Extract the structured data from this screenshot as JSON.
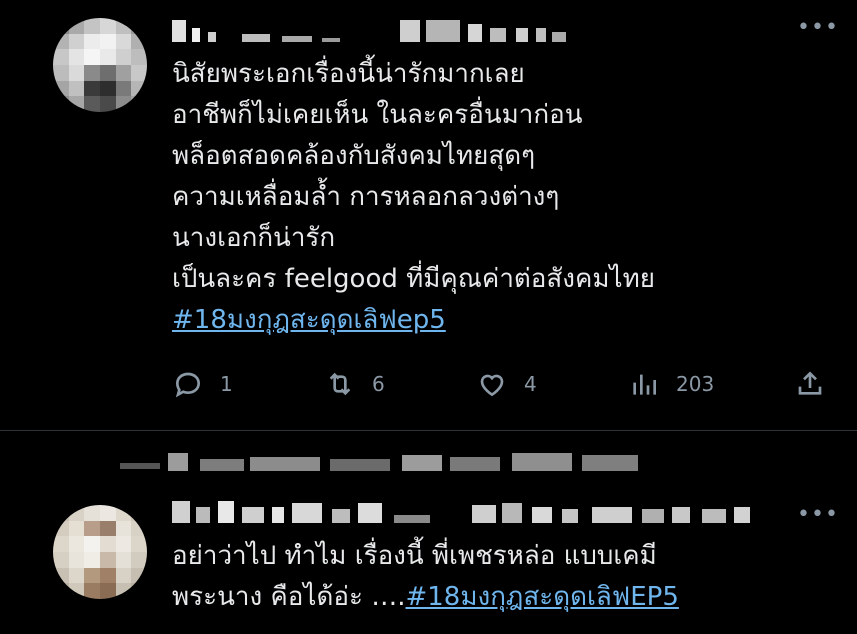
{
  "tweets": [
    {
      "lines": [
        "นิสัยพระเอกเรื่องนี้น่ารักมากเลย",
        "อาชีพก็ไม่เคยเห็น ในละครอื่นมาก่อน",
        "พล็อตสอดคล้องกับสังคมไทยสุดๆ",
        "ความเหลื่อมล้ำ การหลอกลวงต่างๆ",
        "นางเอกก็น่ารัก",
        "เป็นละคร feelgood ที่มีคุณค่าต่อสังคมไทย"
      ],
      "hashtag": "#18มงกุฎสะดุดเลิฟep5",
      "more_label": "•••",
      "actions": {
        "reply_count": "1",
        "retweet_count": "6",
        "like_count": "4",
        "view_count": "203"
      }
    },
    {
      "line1": "อย่าว่าไป  ทำไม เรื่องนี้ พี่เพชรหล่อ แบบเคมี",
      "line2_prefix": "พระนาง คือได้อ่ะ  ….",
      "hashtag": "#18มงกุฎสะดุดเลิฟEP5",
      "more_label": "•••"
    }
  ],
  "icons": {
    "reply": "reply-icon",
    "retweet": "retweet-icon",
    "like": "heart-icon",
    "views": "views-icon",
    "share": "share-icon",
    "more": "more-icon"
  },
  "colors": {
    "background": "#000000",
    "text": "#e7e9ea",
    "muted": "#8b98a5",
    "link": "#1d9bf0",
    "divider": "#2f3336"
  }
}
